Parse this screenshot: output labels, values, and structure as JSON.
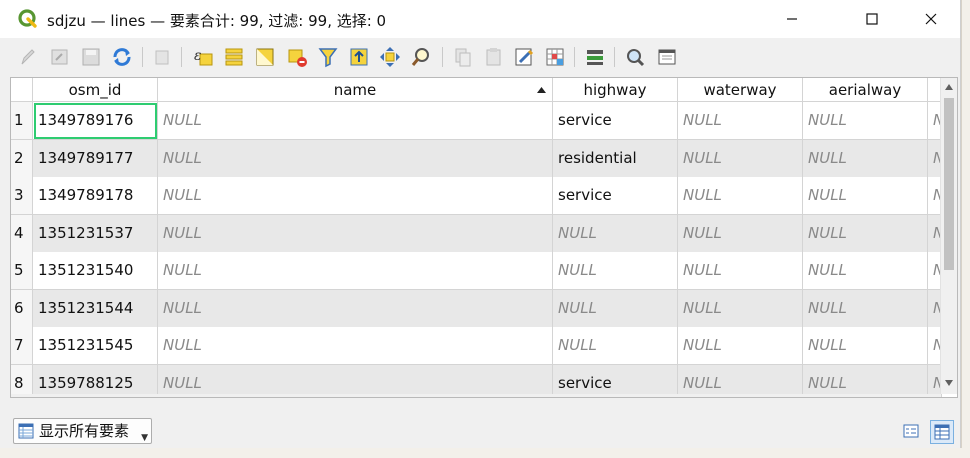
{
  "window": {
    "title": "sdjzu — lines — 要素合计: 99, 过滤: 99, 选择: 0"
  },
  "toolbar": {
    "icons": [
      "edit-pencil-icon",
      "multi-edit-icon",
      "save-edits-icon",
      "reload-icon",
      "add-feature-icon",
      "delete-feature-icon",
      "expression-select-icon",
      "select-all-icon",
      "invert-selection-icon",
      "deselect-all-icon",
      "filter-icon",
      "move-selection-top-icon",
      "pan-to-selection-icon",
      "zoom-to-selection-icon",
      "copy-rows-icon",
      "paste-features-icon",
      "field-calculator-icon",
      "conditional-formatting-icon",
      "actions-icon",
      "search-icon",
      "dock-icon"
    ]
  },
  "table": {
    "columns": [
      "osm_id",
      "name",
      "highway",
      "waterway",
      "aerialway"
    ],
    "sort_column": "name",
    "rows": [
      {
        "num": "1",
        "osm_id": "1349789176",
        "name": "NULL",
        "highway": "service",
        "waterway": "NULL",
        "aerialway": "NULL",
        "more": "N"
      },
      {
        "num": "2",
        "osm_id": "1349789177",
        "name": "NULL",
        "highway": "residential",
        "waterway": "NULL",
        "aerialway": "NULL",
        "more": "N"
      },
      {
        "num": "3",
        "osm_id": "1349789178",
        "name": "NULL",
        "highway": "service",
        "waterway": "NULL",
        "aerialway": "NULL",
        "more": "N"
      },
      {
        "num": "4",
        "osm_id": "1351231537",
        "name": "NULL",
        "highway": "NULL",
        "waterway": "NULL",
        "aerialway": "NULL",
        "more": "N"
      },
      {
        "num": "5",
        "osm_id": "1351231540",
        "name": "NULL",
        "highway": "NULL",
        "waterway": "NULL",
        "aerialway": "NULL",
        "more": "N"
      },
      {
        "num": "6",
        "osm_id": "1351231544",
        "name": "NULL",
        "highway": "NULL",
        "waterway": "NULL",
        "aerialway": "NULL",
        "more": "N"
      },
      {
        "num": "7",
        "osm_id": "1351231545",
        "name": "NULL",
        "highway": "NULL",
        "waterway": "NULL",
        "aerialway": "NULL",
        "more": "N"
      },
      {
        "num": "8",
        "osm_id": "1359788125",
        "name": "NULL",
        "highway": "service",
        "waterway": "NULL",
        "aerialway": "NULL",
        "more": "N"
      }
    ]
  },
  "footer": {
    "filter_label": "显示所有要素"
  },
  "colors": {
    "selected_cell_outline": "#2ecc71",
    "row_alt": "#e8e8e8",
    "null_text": "#8a8a8a"
  }
}
